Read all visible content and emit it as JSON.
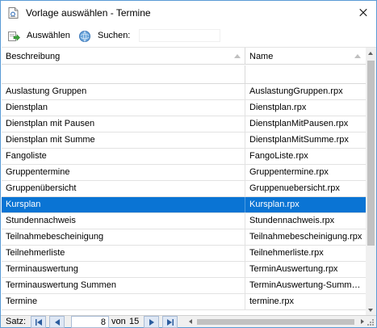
{
  "window": {
    "title": "Vorlage auswählen - Termine",
    "icon": "document-template-icon",
    "close_icon": "close-icon"
  },
  "toolbar": {
    "select_label": "Auswählen",
    "select_icon": "select-arrow-icon",
    "search_label": "Suchen:",
    "search_icon": "search-globe-icon",
    "search_value": ""
  },
  "grid": {
    "columns": [
      "Beschreibung",
      "Name"
    ],
    "selected_index": 6,
    "rows": [
      {
        "beschreibung": "Auslastung Gruppen",
        "name": "AuslastungGruppen.rpx"
      },
      {
        "beschreibung": "Dienstplan",
        "name": "Dienstplan.rpx"
      },
      {
        "beschreibung": "Dienstplan mit Pausen",
        "name": "DienstplanMitPausen.rpx"
      },
      {
        "beschreibung": "Dienstplan mit Summe",
        "name": "DienstplanMitSumme.rpx"
      },
      {
        "beschreibung": "Fangoliste",
        "name": "FangoListe.rpx"
      },
      {
        "beschreibung": "Gruppentermine",
        "name": "Gruppentermine.rpx"
      },
      {
        "beschreibung": "Gruppenübersicht",
        "name": "Gruppenuebersicht.rpx"
      },
      {
        "beschreibung": "Kursplan",
        "name": "Kursplan.rpx"
      },
      {
        "beschreibung": "Stundennachweis",
        "name": "Stundennachweis.rpx"
      },
      {
        "beschreibung": "Teilnahmebescheinigung",
        "name": "Teilnahmebescheinigung.rpx"
      },
      {
        "beschreibung": "Teilnehmerliste",
        "name": "Teilnehmerliste.rpx"
      },
      {
        "beschreibung": "Terminauswertung",
        "name": "TerminAuswertung.rpx"
      },
      {
        "beschreibung": "Terminauswertung Summen",
        "name": "TerminAuswertung-Summen.rpx"
      },
      {
        "beschreibung": "Termine",
        "name": "termine.rpx"
      }
    ]
  },
  "navigator": {
    "label": "Satz:",
    "current": "8",
    "of_label": "von",
    "total": "15"
  },
  "colors": {
    "selection": "#0a74d4",
    "window_border": "#5a9bd5"
  }
}
